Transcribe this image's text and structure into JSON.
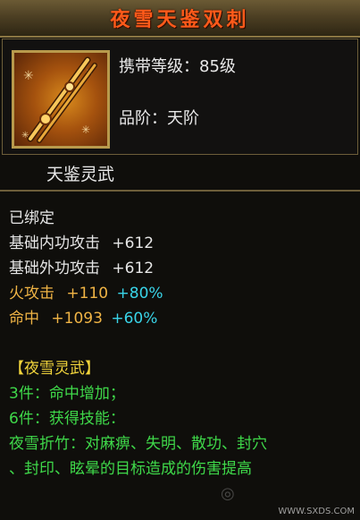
{
  "title": "夜雪天鉴双刺",
  "header": {
    "level_label": "携带等级：85级",
    "grade_label": "品阶：天阶"
  },
  "item_icon": "twin-daggers-icon",
  "subtitle": "天鉴灵武",
  "stats": {
    "bound": "已绑定",
    "inner_attack": {
      "label": "基础内功攻击",
      "value": "+612"
    },
    "outer_attack": {
      "label": "基础外功攻击",
      "value": "+612"
    },
    "fire_attack": {
      "label": "火攻击",
      "value": "+110",
      "bonus": "+80%"
    },
    "hit": {
      "label": "命中",
      "value": "+1093",
      "bonus": "+60%"
    }
  },
  "set": {
    "name": "【夜雪灵武】",
    "three_piece": "3件：命中增加；",
    "six_piece": "6件：获得技能：",
    "skill_line1": "夜雪折竹：对麻痹、失明、散功、封穴",
    "skill_line2": "、封印、眩晕的目标造成的伤害提高"
  },
  "watermark": "WWW.SXDS.COM",
  "colors": {
    "title": "#ff5a1a",
    "white": "#e6e6e6",
    "orange": "#f0b445",
    "cyan": "#39d4e8",
    "yellow": "#f2d53c",
    "green": "#3fd94a",
    "border": "#6d5e3a"
  }
}
